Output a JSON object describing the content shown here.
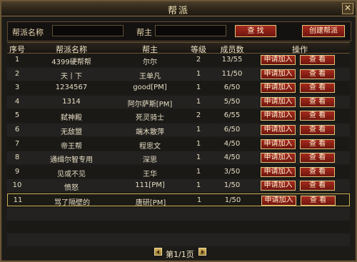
{
  "window": {
    "title": "帮派",
    "close_label": "✕"
  },
  "search": {
    "name_label": "帮派名称",
    "leader_label": "帮主",
    "search_button": "查  找",
    "create_button": "创建帮派"
  },
  "table": {
    "headers": [
      "序号",
      "帮派名称",
      "帮主",
      "等级",
      "成员数",
      "操作"
    ],
    "apply_label": "申请加入",
    "view_label": "查  看",
    "rows": [
      {
        "id": "1",
        "name": "4399硬帮帮",
        "leader": "尔尔",
        "level": "2",
        "members": "13/55"
      },
      {
        "id": "2",
        "name": "天丨下",
        "leader": "王单凡",
        "level": "1",
        "members": "11/50"
      },
      {
        "id": "3",
        "name": "1234567",
        "leader": "good[PM]",
        "level": "1",
        "members": "6/50"
      },
      {
        "id": "4",
        "name": "1314",
        "leader": "阿尔萨斯[PM]",
        "level": "1",
        "members": "5/50"
      },
      {
        "id": "5",
        "name": "弑神殿",
        "leader": "死灵骑士",
        "level": "2",
        "members": "6/55"
      },
      {
        "id": "6",
        "name": "无敌盟",
        "leader": "端木散萍",
        "level": "1",
        "members": "6/50"
      },
      {
        "id": "7",
        "name": "帝王帮",
        "leader": "程思文",
        "level": "1",
        "members": "4/50"
      },
      {
        "id": "8",
        "name": "通缉尔智专用",
        "leader": "深思",
        "level": "1",
        "members": "4/50"
      },
      {
        "id": "9",
        "name": "见或不见",
        "leader": "王华",
        "level": "1",
        "members": "3/50"
      },
      {
        "id": "10",
        "name": "愤怒",
        "leader": "111[PM]",
        "level": "1",
        "members": "1/50"
      },
      {
        "id": "11",
        "name": "骂了隔壁的",
        "leader": "唐研[PM]",
        "level": "1",
        "members": "1/50"
      }
    ]
  },
  "pager": {
    "label": "第1/1页"
  }
}
